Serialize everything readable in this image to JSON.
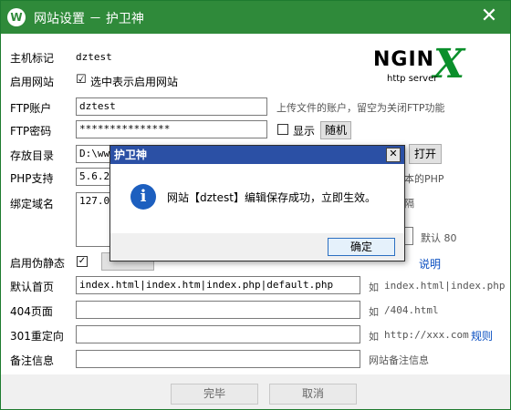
{
  "titlebar": {
    "logo_letter": "W",
    "title": "网站设置 － 护卫神",
    "close": "✕"
  },
  "logo": {
    "main": "NGIN",
    "x": "X",
    "sub": "http server",
    "registered": "®"
  },
  "form": {
    "host_label": "主机标记",
    "host_value": "dztest",
    "enable_label": "启用网站",
    "enable_checkbox": "☑",
    "enable_text": "选中表示启用网站",
    "ftp_user_label": "FTP账户",
    "ftp_user_value": "dztest",
    "ftp_user_hint": "上传文件的账户，留空为关闭FTP功能",
    "ftp_pass_label": "FTP密码",
    "ftp_pass_value": "***************",
    "show_text": "显示",
    "random_button": "随机",
    "dir_label": "存放目录",
    "dir_value": "D:\\www",
    "open_button": "打开",
    "php_label": "PHP支持",
    "php_value": "5.6.25",
    "php_hint": "本的PHP",
    "domain_label": "绑定域名",
    "domain_value": "127.0.",
    "domain_hint": "隔",
    "port_default": "默认 80",
    "rewrite_label": "启用伪静态",
    "rewrite_check": "✓",
    "rewrite_link": "说明",
    "index_label": "默认首页",
    "index_value": "index.html|index.htm|index.php|default.php",
    "index_hint_prefix": "如",
    "index_hint_value": "index.html|index.php",
    "e404_label": "404页面",
    "e404_value": "",
    "e404_hint_prefix": "如",
    "e404_hint_value": "/404.html",
    "redir_label": "301重定向",
    "redir_value": "",
    "redir_hint_prefix": "如",
    "redir_hint_value": "http://xxx.com",
    "rules_link": "规则",
    "note_label": "备注信息",
    "note_value": "",
    "note_hint": "网站备注信息"
  },
  "footer": {
    "finish_button": "完毕",
    "cancel_button": "取消"
  },
  "dialog": {
    "title": "护卫神",
    "close": "✕",
    "icon": "i",
    "message": "网站【dztest】编辑保存成功，立即生效。",
    "ok_button": "确定"
  }
}
